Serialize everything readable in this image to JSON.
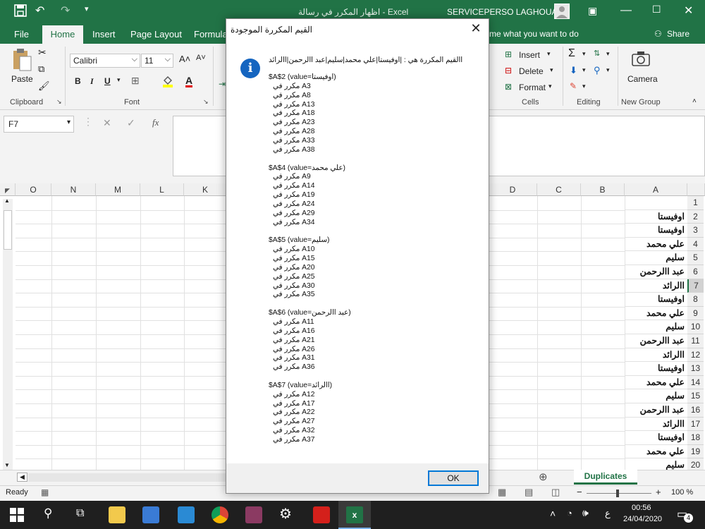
{
  "window": {
    "title": "اظهار المكرر في رسالة  -  Excel",
    "user": "SERVICEPERSO LAGHOUAT",
    "tell_me": "me what you want to do",
    "share": "Share"
  },
  "tabs": [
    "File",
    "Home",
    "Insert",
    "Page Layout",
    "Formulas"
  ],
  "ribbon": {
    "paste": "Paste",
    "clipboard": "Clipboard",
    "font_name": "Calibri",
    "font_size": "11",
    "font_group": "Font",
    "bold": "B",
    "italic": "I",
    "underline": "U",
    "insert": "Insert",
    "delete": "Delete",
    "format": "Format",
    "cells": "Cells",
    "editing": "Editing",
    "camera": "Camera",
    "new_group": "New Group"
  },
  "formula_bar": {
    "name_box": "F7",
    "fx": "fx"
  },
  "grid": {
    "left_columns": [
      "O",
      "N",
      "M",
      "L",
      "K"
    ],
    "right_columns": [
      "D",
      "C",
      "B",
      "A"
    ],
    "rows": [
      {
        "num": "1",
        "a": ""
      },
      {
        "num": "2",
        "a": "اوفيستا"
      },
      {
        "num": "3",
        "a": "اوفيستا"
      },
      {
        "num": "4",
        "a": "علي محمد"
      },
      {
        "num": "5",
        "a": "سليم"
      },
      {
        "num": "6",
        "a": "عبد االرحمن"
      },
      {
        "num": "7",
        "a": "االرائد"
      },
      {
        "num": "8",
        "a": "اوفيستا"
      },
      {
        "num": "9",
        "a": "علي محمد"
      },
      {
        "num": "10",
        "a": "سليم"
      },
      {
        "num": "11",
        "a": "عبد االرحمن"
      },
      {
        "num": "12",
        "a": "االرائد"
      },
      {
        "num": "13",
        "a": "اوفيستا"
      },
      {
        "num": "14",
        "a": "علي محمد"
      },
      {
        "num": "15",
        "a": "سليم"
      },
      {
        "num": "16",
        "a": "عبد االرحمن"
      },
      {
        "num": "17",
        "a": "االرائد"
      },
      {
        "num": "18",
        "a": "اوفيستا"
      },
      {
        "num": "19",
        "a": "علي محمد"
      },
      {
        "num": "20",
        "a": "سليم"
      }
    ]
  },
  "sheet_tab": "Duplicates",
  "status": {
    "ready": "Ready",
    "zoom": "100 %"
  },
  "taskbar": {
    "time": "00:56",
    "date": "24/04/2020",
    "lang": "ع",
    "notif": "4"
  },
  "dialog": {
    "title": "القيم المكررة الموجودة",
    "close": "✕",
    "summary": "االقيم المكررة هي : |اوفيستا|علي محمد|سليم|عبد االرحمن|االرائد",
    "groups": [
      {
        "header": "$A$2 (value=اوفيستا)",
        "items": [
          "مكرر في A3",
          "مكرر في A8",
          "مكرر في A13",
          "مكرر في A18",
          "مكرر في A23",
          "مكرر في A28",
          "مكرر في A33",
          "مكرر في A38"
        ]
      },
      {
        "header": "$A$4 (value=علي محمد)",
        "items": [
          "مكرر في A9",
          "مكرر في A14",
          "مكرر في A19",
          "مكرر في A24",
          "مكرر في A29",
          "مكرر في A34"
        ]
      },
      {
        "header": "$A$5 (value=سليم)",
        "items": [
          "مكرر في A10",
          "مكرر في A15",
          "مكرر في A20",
          "مكرر في A25",
          "مكرر في A30",
          "مكرر في A35"
        ]
      },
      {
        "header": "$A$6 (value=عبد االرحمن)",
        "items": [
          "مكرر في A11",
          "مكرر في A16",
          "مكرر في A21",
          "مكرر في A26",
          "مكرر في A31",
          "مكرر في A36"
        ]
      },
      {
        "header": "$A$7 (value=االرائد)",
        "items": [
          "مكرر في A12",
          "مكرر في A17",
          "مكرر في A22",
          "مكرر في A27",
          "مكرر في A32",
          "مكرر في A37"
        ]
      }
    ],
    "ok": "OK"
  }
}
